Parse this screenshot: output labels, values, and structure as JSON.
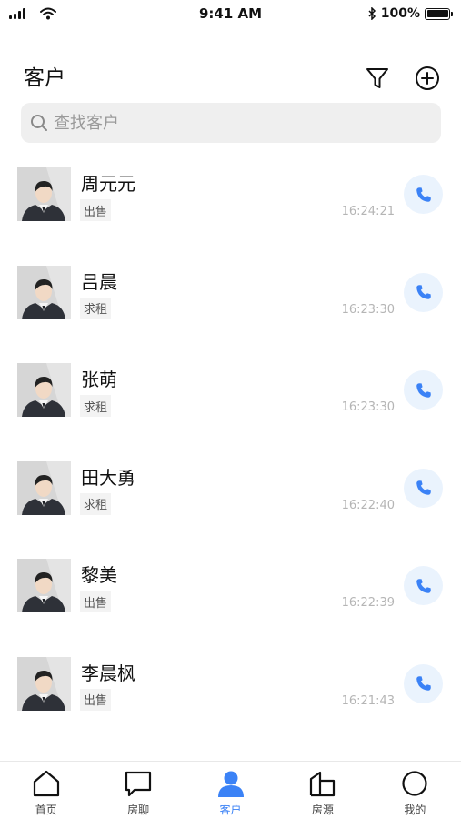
{
  "status_bar": {
    "time": "9:41 AM",
    "battery": "100%",
    "battery_level": 1.0
  },
  "header": {
    "title": "客户",
    "filter_icon": "filter-icon",
    "add_icon": "plus-circle-icon"
  },
  "search": {
    "placeholder": "查找客户",
    "value": ""
  },
  "customers": [
    {
      "name": "周元元",
      "tag": "出售",
      "time": "16:24:21"
    },
    {
      "name": "吕晨",
      "tag": "求租",
      "time": "16:23:30"
    },
    {
      "name": "张萌",
      "tag": "求租",
      "time": "16:23:30"
    },
    {
      "name": "田大勇",
      "tag": "求租",
      "time": "16:22:40"
    },
    {
      "name": "黎美",
      "tag": "出售",
      "time": "16:22:39"
    },
    {
      "name": "李晨枫",
      "tag": "出售",
      "time": "16:21:43"
    }
  ],
  "tabs": [
    {
      "label": "首页",
      "icon": "home-icon",
      "active": false
    },
    {
      "label": "房聊",
      "icon": "chat-icon",
      "active": false
    },
    {
      "label": "客户",
      "icon": "person-icon",
      "active": true
    },
    {
      "label": "房源",
      "icon": "building-icon",
      "active": false
    },
    {
      "label": "我的",
      "icon": "profile-circle-icon",
      "active": false
    }
  ],
  "colors": {
    "accent": "#3b82f6",
    "call_bg": "#eaf3fd",
    "search_bg": "#efefef"
  }
}
